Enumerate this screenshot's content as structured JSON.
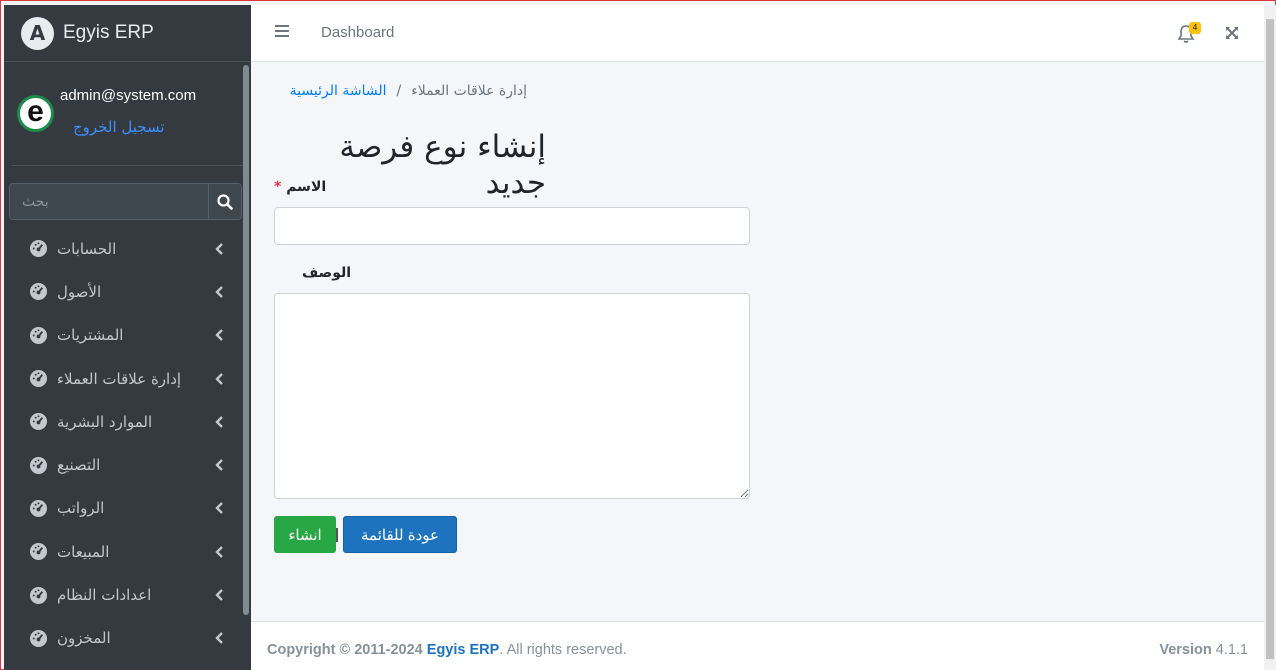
{
  "brand": {
    "logo_letter": "A",
    "name": "Egyis ERP"
  },
  "user": {
    "avatar_letter": "e",
    "email": "admin@system.com",
    "logout": "تسجيل الخروج"
  },
  "sidebar": {
    "search_placeholder": "بحث",
    "items": [
      {
        "label": "الحسابات"
      },
      {
        "label": "الأصول"
      },
      {
        "label": "المشتريات"
      },
      {
        "label": "إدارة علاقات العملاء"
      },
      {
        "label": "الموارد البشرية"
      },
      {
        "label": "التصنيع"
      },
      {
        "label": "الرواتب"
      },
      {
        "label": "المبيعات"
      },
      {
        "label": "اعدادات النظام"
      },
      {
        "label": "المخزون"
      }
    ]
  },
  "topbar": {
    "dashboard_link": "Dashboard",
    "notification_count": "4"
  },
  "breadcrumb": {
    "home": "الشاشة الرئيسية",
    "separator": "/",
    "current": "إدارة علاقات العملاء"
  },
  "page": {
    "title": "إنشاء نوع فرصة جديد",
    "fields": {
      "name_label": "الاسم",
      "required_mark": "*",
      "description_label": "الوصف"
    },
    "buttons": {
      "create": "انشاء",
      "back": "عودة للقائمة"
    }
  },
  "footer": {
    "copyright_prefix": "Copyright © 2011-2024",
    "brand": "Egyis ERP",
    "rights": ". All rights reserved.",
    "version_label": "Version",
    "version_number": "4.1.1"
  },
  "colors": {
    "sidebar_bg": "#343a40",
    "create_button": "#28a745",
    "back_button": "#1e73be",
    "link": "#007bff"
  }
}
